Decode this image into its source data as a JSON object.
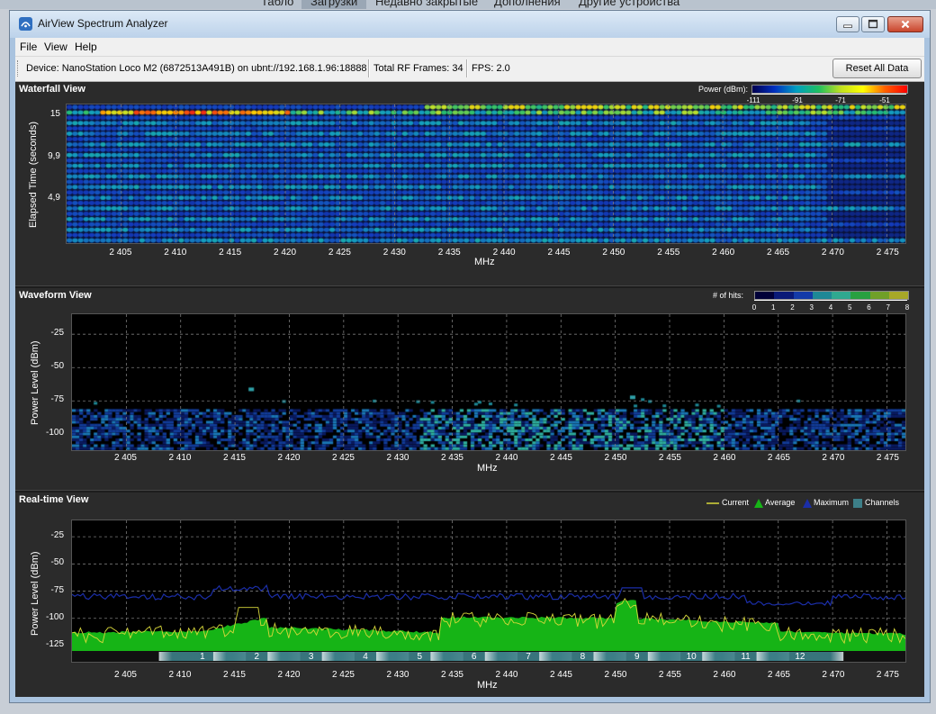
{
  "browser_tabs": [
    "Табло",
    "Загрузки",
    "Недавно закрытые",
    "Дополнения",
    "Другие устройства"
  ],
  "window": {
    "title": "AirView Spectrum Analyzer",
    "menu": [
      "File",
      "View",
      "Help"
    ]
  },
  "toolbar": {
    "device": "Device: NanoStation Loco M2 (6872513A491B) on ubnt://192.168.1.96:18888",
    "frames": "Total RF Frames: 34",
    "fps": "FPS: 2.0",
    "reset_label": "Reset All Data"
  },
  "colors": {
    "panel_bg": "#2b2b2b",
    "plot_bg": "#000000",
    "current": "#d8d83a",
    "average": "#16b416",
    "maximum": "#1b2ea8",
    "channels": "#3d7f88"
  },
  "freq_axis": {
    "label": "MHz",
    "ticks": [
      "2 405",
      "2 410",
      "2 415",
      "2 420",
      "2 425",
      "2 430",
      "2 435",
      "2 440",
      "2 445",
      "2 450",
      "2 455",
      "2 460",
      "2 465",
      "2 470",
      "2 475"
    ],
    "min": 2400,
    "max": 2476.7
  },
  "waterfall": {
    "title": "Waterfall View",
    "legend_label": "Power (dBm):",
    "legend_ticks": [
      "-111",
      "-91",
      "-71",
      "-51"
    ],
    "ylabel": "Elapsed Time (seconds)",
    "yticks": [
      "15",
      "9,9",
      "4,9"
    ]
  },
  "waveform": {
    "title": "Waveform View",
    "legend_label": "# of hits:",
    "legend_ticks": [
      "0",
      "1",
      "2",
      "3",
      "4",
      "5",
      "6",
      "7",
      "8"
    ],
    "ylabel": "Power Level (dBm)",
    "yticks": [
      "-25",
      "-50",
      "-75",
      "-100"
    ]
  },
  "realtime": {
    "title": "Real-time View",
    "legend": [
      "Current",
      "Average",
      "Maximum",
      "Channels"
    ],
    "ylabel": "Power Level (dBm)",
    "yticks": [
      "-25",
      "-50",
      "-75",
      "-100",
      "-125"
    ],
    "channels": [
      "1",
      "2",
      "3",
      "4",
      "5",
      "6",
      "7",
      "8",
      "9",
      "10",
      "11",
      "12"
    ]
  }
}
